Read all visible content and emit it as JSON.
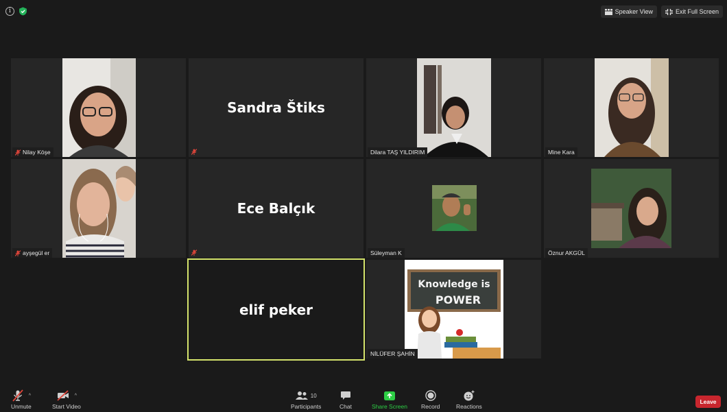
{
  "topbar": {
    "speaker_view_label": "Speaker View",
    "exit_full_screen_label": "Exit Full Screen"
  },
  "participants": [
    {
      "name": "Nilay Köşe",
      "muted": true,
      "video": true
    },
    {
      "name": "Sandra Štiks",
      "muted": true,
      "video": false
    },
    {
      "name": "Dilara TAŞ YILDIRIM",
      "muted": false,
      "video": true
    },
    {
      "name": "Mine Kara",
      "muted": false,
      "video": true
    },
    {
      "name": "ayşegül er",
      "muted": true,
      "video": true
    },
    {
      "name": "Ece Balçık",
      "muted": true,
      "video": false
    },
    {
      "name": "Süleyman K",
      "muted": false,
      "video": true
    },
    {
      "name": "Öznur AKGÜL",
      "muted": false,
      "video": true
    },
    {
      "name": "elif peker",
      "muted": false,
      "video": false,
      "active_speaker": true
    },
    {
      "name": "NİLÜFER ŞAHİN",
      "muted": false,
      "video": true,
      "image_text": [
        "Knowledge is",
        "POWER"
      ]
    }
  ],
  "toolbar": {
    "unmute_label": "Unmute",
    "start_video_label": "Start Video",
    "participants_label": "Participants",
    "participants_count": "10",
    "chat_label": "Chat",
    "share_screen_label": "Share Screen",
    "record_label": "Record",
    "reactions_label": "Reactions",
    "leave_label": "Leave"
  },
  "colors": {
    "active_border": "#d4e36b",
    "share_green": "#2dce45",
    "leave_red": "#c8262e",
    "muted_red": "#e0453a"
  }
}
